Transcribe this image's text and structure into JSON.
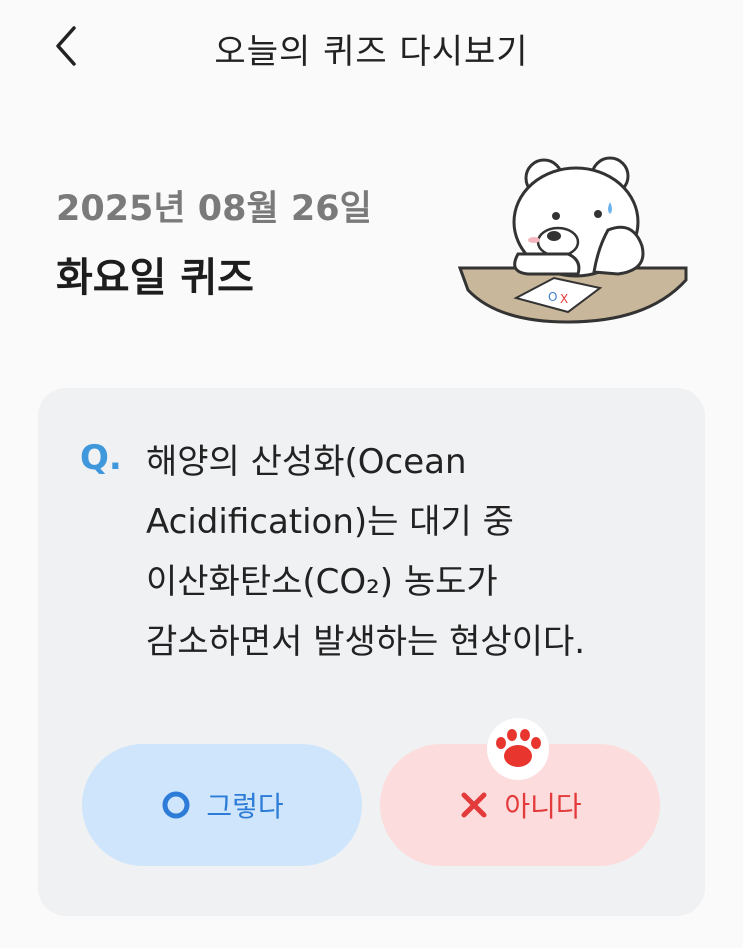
{
  "header": {
    "title": "오늘의 퀴즈 다시보기",
    "back_icon": "chevron-left-icon"
  },
  "quiz": {
    "date": "2025년 08월 26일",
    "day_title": "화요일 퀴즈",
    "mascot": "polar-bear-thinking-illustration",
    "q_label": "Q.",
    "question_lines": [
      "해양의 산성화(Ocean",
      "Acidification)는 대기 중",
      "이산화탄소(CO₂) 농도가",
      "감소하면서 발생하는 현상이다."
    ]
  },
  "answers": {
    "yes_label": "그렇다",
    "yes_icon": "circle-o-icon",
    "no_label": "아니다",
    "no_icon": "x-mark-icon",
    "selected_marker_icon": "paw-icon"
  },
  "colors": {
    "accent_blue": "#3f97dc",
    "yes_bg": "#cfe5fb",
    "no_bg": "#fddcdd",
    "no_fg": "#e33b3b",
    "card_bg": "#f0f1f3"
  }
}
